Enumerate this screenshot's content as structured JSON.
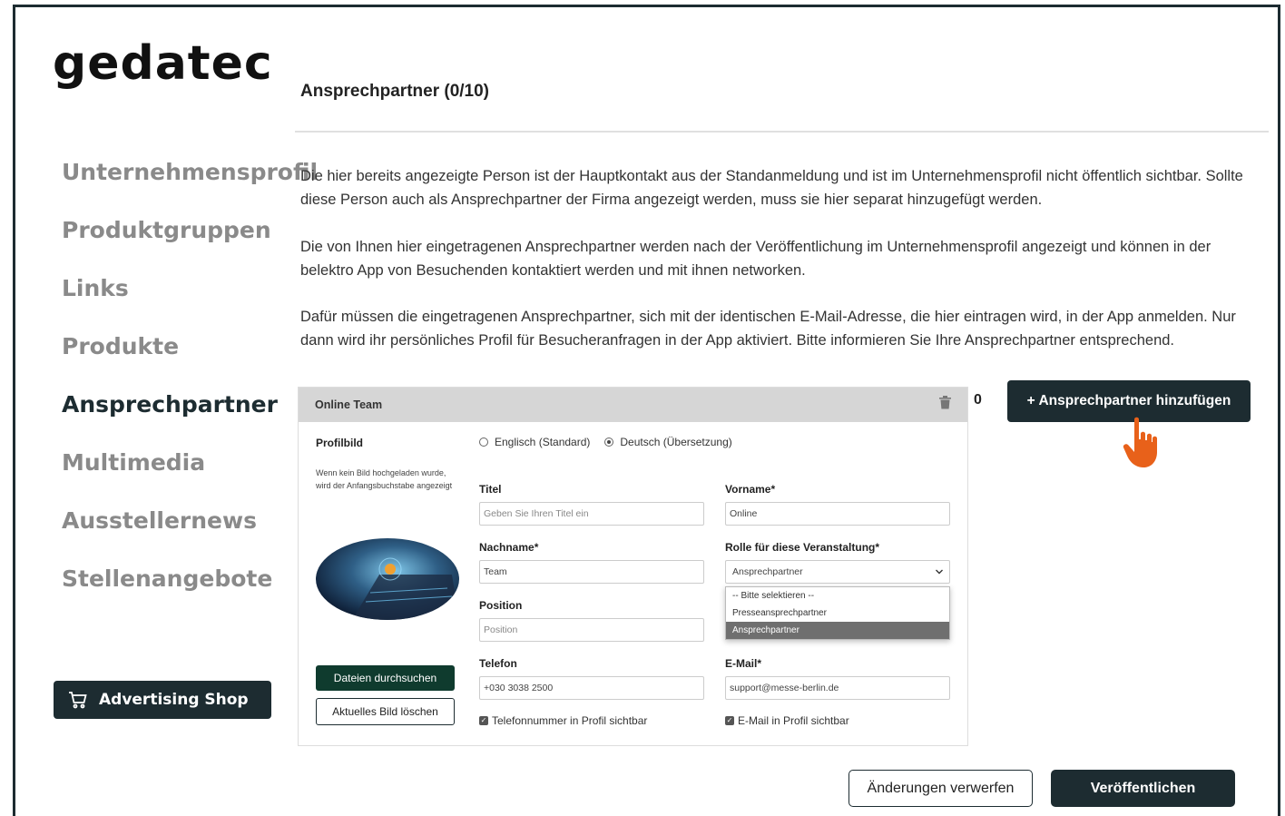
{
  "brand": {
    "logo_text": "gedatec"
  },
  "sidebar": {
    "items": [
      {
        "label": "Unternehmensprofil",
        "active": false
      },
      {
        "label": "Produktgruppen",
        "active": false
      },
      {
        "label": "Links",
        "active": false
      },
      {
        "label": "Produkte",
        "active": false
      },
      {
        "label": "Ansprechpartner",
        "active": true
      },
      {
        "label": "Multimedia",
        "active": false
      },
      {
        "label": "Ausstellernews",
        "active": false
      },
      {
        "label": "Stellenangebote",
        "active": false
      }
    ],
    "advertising_shop": "Advertising Shop"
  },
  "main": {
    "title": "Ansprechpartner (0/10)",
    "paragraphs": [
      "Die hier bereits angezeigte Person ist der Hauptkontakt aus der Standanmeldung und ist im Unternehmensprofil nicht öffentlich sichtbar. Sollte diese Person auch als Ansprechpartner der Firma angezeigt werden, muss sie hier separat hinzugefügt werden.",
      "Die von Ihnen hier eingetragenen Ansprechpartner werden nach der Veröffentlichung im Unternehmensprofil angezeigt und können in der belektro App von Besuchenden kontaktiert werden und mit ihnen networken.",
      "Dafür müssen die eingetragenen Ansprechpartner, sich mit der identischen E-Mail-Adresse, die hier eintragen wird, in der App anmelden. Nur dann wird ihr persönliches Profil für Besucheranfragen in der App aktiviert. Bitte informieren Sie Ihre Ansprechpartner entsprechend."
    ],
    "counter": "0",
    "add_button": "+ Ansprechpartner hinzufügen"
  },
  "card": {
    "header_name": "Online Team",
    "profilbild_label": "Profilbild",
    "profilbild_hint": "Wenn kein Bild hochgeladen wurde, wird der Anfangsbuchstabe angezeigt",
    "lang_en": "Englisch (Standard)",
    "lang_de": "Deutsch (Übersetzung)",
    "titel_label": "Titel",
    "titel_placeholder": "Geben Sie Ihren Titel ein",
    "vorname_label": "Vorname*",
    "vorname_value": "Online",
    "nachname_label": "Nachname*",
    "nachname_value": "Team",
    "rolle_label": "Rolle für diese Veranstaltung*",
    "rolle_value": "Ansprechpartner",
    "rolle_options": [
      "-- Bitte selektieren --",
      "Presseansprechpartner",
      "Ansprechpartner"
    ],
    "position_label": "Position",
    "position_placeholder": "Position",
    "telefon_label": "Telefon",
    "telefon_value": "+030 3038 2500",
    "email_label": "E-Mail*",
    "email_value": "support@messe-berlin.de",
    "browse_button": "Dateien durchsuchen",
    "delete_image_button": "Aktuelles Bild löschen",
    "phone_visible": "Telefonnummer in Profil sichtbar",
    "email_visible": "E-Mail in Profil sichtbar"
  },
  "footer": {
    "discard": "Änderungen verwerfen",
    "publish": "Veröffentlichen"
  },
  "colors": {
    "primary": "#1d2c31",
    "green": "#0f3b2e",
    "cursor": "#e8611a"
  }
}
